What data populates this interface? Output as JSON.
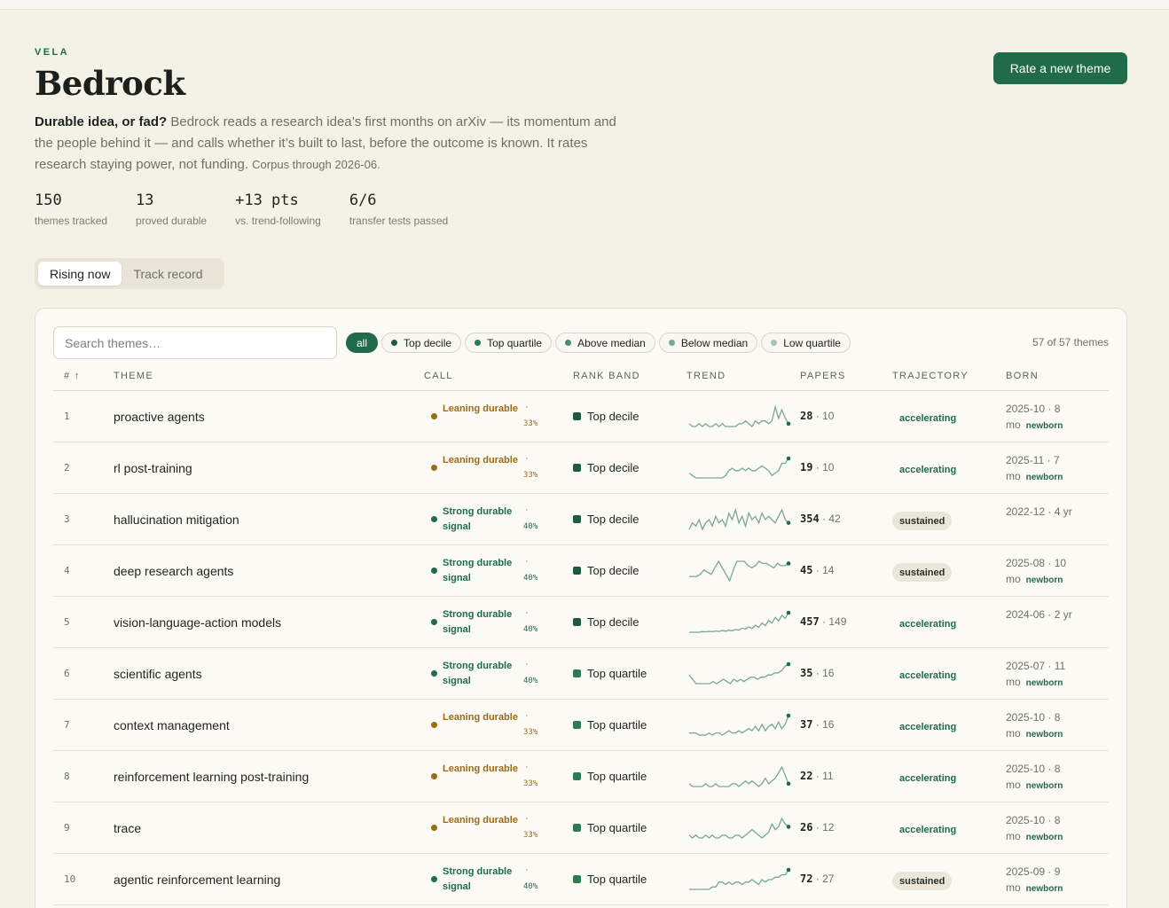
{
  "brand": "VELA",
  "title": "Bedrock",
  "action_button": "Rate a new theme",
  "description": {
    "lead": "Durable idea, or fad?",
    "body": " Bedrock reads a research idea’s first months on arXiv — its momentum and the people behind it — and calls whether it’s built to last, before the outcome is known. It rates research staying power, not funding. ",
    "corpus": "Corpus through 2026-06."
  },
  "stats": [
    {
      "value": "150",
      "label": "themes tracked"
    },
    {
      "value": "13",
      "label": "proved durable"
    },
    {
      "value": "+13 pts",
      "label": "vs. trend-following"
    },
    {
      "value": "6/6",
      "label": "transfer tests passed"
    }
  ],
  "view_tabs": [
    {
      "label": "Rising now",
      "active": true
    },
    {
      "label": "Track record",
      "active": false
    }
  ],
  "search": {
    "placeholder": "Search themes…",
    "value": ""
  },
  "filters": [
    {
      "label": "all",
      "color": null,
      "active": true
    },
    {
      "label": "Top decile",
      "color": "#1f5a3f",
      "active": false
    },
    {
      "label": "Top quartile",
      "color": "#2e7a55",
      "active": false
    },
    {
      "label": "Above median",
      "color": "#4f8a6c",
      "active": false
    },
    {
      "label": "Below median",
      "color": "#7fa592",
      "active": false
    },
    {
      "label": "Low quartile",
      "color": "#a9c3b4",
      "active": false
    }
  ],
  "count_label": "57 of 57 themes",
  "columns": {
    "num": "# ↑",
    "theme": "THEME",
    "call": "CALL",
    "band": "RANK BAND",
    "trend": "TREND",
    "papers": "PAPERS",
    "trajectory": "TRAJECTORY",
    "born": "BORN"
  },
  "colors": {
    "accent": "#1f6b4a",
    "leaning": "#9a6b12",
    "strong": "#1f6b4a",
    "top_decile": "#1f5a3f",
    "top_quartile": "#2e7a55",
    "sparkline": "#7aa88f"
  },
  "rows": [
    {
      "num": "1",
      "theme": "proactive agents",
      "call": "Leaning durable",
      "call_kind": "leaning",
      "sep": "·",
      "pct": "33%",
      "band": "Top decile",
      "band_kind": "top_decile",
      "papers": "28",
      "papers_recent": "· 10",
      "trajectory": "accelerating",
      "born_date": "2025-10 · 8",
      "born_unit": "mo",
      "newborn": "newborn",
      "trend": [
        3,
        2,
        2,
        3,
        2,
        3,
        2,
        2,
        3,
        2,
        3,
        2,
        2,
        2,
        2,
        3,
        3,
        4,
        3,
        2,
        4,
        3,
        4,
        4,
        3,
        4,
        9,
        5,
        8,
        5,
        3
      ]
    },
    {
      "num": "2",
      "theme": "rl post-training",
      "call": "Leaning durable",
      "call_kind": "leaning",
      "sep": "·",
      "pct": "33%",
      "band": "Top decile",
      "band_kind": "top_decile",
      "papers": "19",
      "papers_recent": "· 10",
      "trajectory": "accelerating",
      "born_date": "2025-11 · 7",
      "born_unit": "mo",
      "newborn": "newborn",
      "trend": [
        4,
        3,
        2,
        2,
        2,
        2,
        2,
        2,
        2,
        2,
        2,
        3,
        5,
        6,
        5,
        5,
        6,
        5,
        6,
        5,
        5,
        6,
        7,
        6,
        5,
        3,
        4,
        5,
        8,
        8,
        10
      ]
    },
    {
      "num": "3",
      "theme": "hallucination mitigation",
      "call": "Strong durable signal",
      "call_kind": "strong",
      "sep": "·",
      "pct": "40%",
      "band": "Top decile",
      "band_kind": "top_decile",
      "papers": "354",
      "papers_recent": "· 42",
      "trajectory": "sustained",
      "born_date": "2022-12 · 4 yr",
      "born_unit": "",
      "newborn": "",
      "trend": [
        3,
        5,
        4,
        6,
        3,
        5,
        6,
        4,
        7,
        5,
        6,
        4,
        8,
        6,
        9,
        5,
        7,
        4,
        8,
        6,
        7,
        5,
        8,
        6,
        7,
        6,
        5,
        7,
        9,
        6,
        5
      ]
    },
    {
      "num": "4",
      "theme": "deep research agents",
      "call": "Strong durable signal",
      "call_kind": "strong",
      "sep": "·",
      "pct": "40%",
      "band": "Top decile",
      "band_kind": "top_decile",
      "papers": "45",
      "papers_recent": "· 14",
      "trajectory": "sustained",
      "born_date": "2025-08 · 10",
      "born_unit": "mo",
      "newborn": "newborn",
      "trend": [
        3,
        3,
        3,
        4,
        6,
        5,
        4,
        7,
        10,
        7,
        4,
        1,
        6,
        10,
        10,
        10,
        8,
        7,
        8,
        10,
        9,
        9,
        8,
        7,
        9,
        8,
        8,
        9
      ]
    },
    {
      "num": "5",
      "theme": "vision-language-action models",
      "call": "Strong durable signal",
      "call_kind": "strong",
      "sep": "·",
      "pct": "40%",
      "band": "Top decile",
      "band_kind": "top_decile",
      "papers": "457",
      "papers_recent": "· 149",
      "trajectory": "accelerating",
      "born_date": "2024-06 · 2 yr",
      "born_unit": "",
      "newborn": "",
      "trend": [
        1,
        1,
        1,
        1,
        1.3,
        1.2,
        1.4,
        1.3,
        1.6,
        1.4,
        1.8,
        1.5,
        2,
        1.7,
        2.4,
        2,
        3,
        2.6,
        3.6,
        2.8,
        4.4,
        3.4,
        5.5,
        4.3,
        6.8,
        5.4,
        8.2,
        6.5,
        9.2,
        7.8,
        10.5
      ]
    },
    {
      "num": "6",
      "theme": "scientific agents",
      "call": "Strong durable signal",
      "call_kind": "strong",
      "sep": "·",
      "pct": "40%",
      "band": "Top quartile",
      "band_kind": "top_quartile",
      "papers": "35",
      "papers_recent": "· 16",
      "trajectory": "accelerating",
      "born_date": "2025-07 · 11",
      "born_unit": "mo",
      "newborn": "newborn",
      "trend": [
        5,
        3,
        1,
        1,
        1,
        1,
        1,
        2,
        1,
        2,
        3,
        2,
        1,
        3,
        2,
        3,
        2,
        3,
        4,
        4,
        3,
        4,
        4,
        5,
        5,
        6,
        6,
        7,
        9,
        10
      ]
    },
    {
      "num": "7",
      "theme": "context management",
      "call": "Leaning durable",
      "call_kind": "leaning",
      "sep": "·",
      "pct": "33%",
      "band": "Top quartile",
      "band_kind": "top_quartile",
      "papers": "37",
      "papers_recent": "· 16",
      "trajectory": "accelerating",
      "born_date": "2025-10 · 8",
      "born_unit": "mo",
      "newborn": "newborn",
      "trend": [
        2,
        2,
        2,
        1,
        1,
        1,
        2,
        1,
        2,
        2,
        1,
        2,
        3,
        2,
        2,
        3,
        2,
        3,
        4,
        3,
        5,
        3,
        6,
        3,
        5,
        6,
        4,
        7,
        4,
        6,
        10
      ]
    },
    {
      "num": "8",
      "theme": "reinforcement learning post-training",
      "call": "Leaning durable",
      "call_kind": "leaning",
      "sep": "·",
      "pct": "33%",
      "band": "Top quartile",
      "band_kind": "top_quartile",
      "papers": "22",
      "papers_recent": "· 11",
      "trajectory": "accelerating",
      "born_date": "2025-10 · 8",
      "born_unit": "mo",
      "newborn": "newborn",
      "trend": [
        3,
        2,
        2,
        2,
        2,
        3,
        2,
        2,
        3,
        2,
        2,
        2,
        2,
        3,
        3,
        2,
        3,
        4,
        3,
        4,
        3,
        2,
        3,
        5,
        3,
        4,
        5,
        7,
        9,
        6,
        3
      ]
    },
    {
      "num": "9",
      "theme": "trace",
      "call": "Leaning durable",
      "call_kind": "leaning",
      "sep": "·",
      "pct": "33%",
      "band": "Top quartile",
      "band_kind": "top_quartile",
      "papers": "26",
      "papers_recent": "· 12",
      "trajectory": "accelerating",
      "born_date": "2025-10 · 8",
      "born_unit": "mo",
      "newborn": "newborn",
      "trend": [
        3,
        2,
        3,
        2,
        2,
        3,
        2,
        3,
        2,
        2,
        3,
        3,
        2,
        2,
        3,
        3,
        2,
        3,
        4,
        5,
        4,
        3,
        2,
        3,
        4,
        7,
        5,
        6,
        9,
        7,
        6
      ]
    },
    {
      "num": "10",
      "theme": "agentic reinforcement learning",
      "call": "Strong durable signal",
      "call_kind": "strong",
      "sep": "·",
      "pct": "40%",
      "band": "Top quartile",
      "band_kind": "top_quartile",
      "papers": "72",
      "papers_recent": "· 27",
      "trajectory": "sustained",
      "born_date": "2025-09 · 9",
      "born_unit": "mo",
      "newborn": "newborn",
      "trend": [
        2,
        2,
        2,
        2,
        2,
        2,
        2,
        3,
        3,
        5,
        5,
        4,
        5,
        4,
        5,
        5,
        4,
        5,
        5,
        6,
        5,
        4,
        6,
        5,
        6,
        6,
        7,
        7,
        8,
        8,
        10
      ]
    }
  ]
}
